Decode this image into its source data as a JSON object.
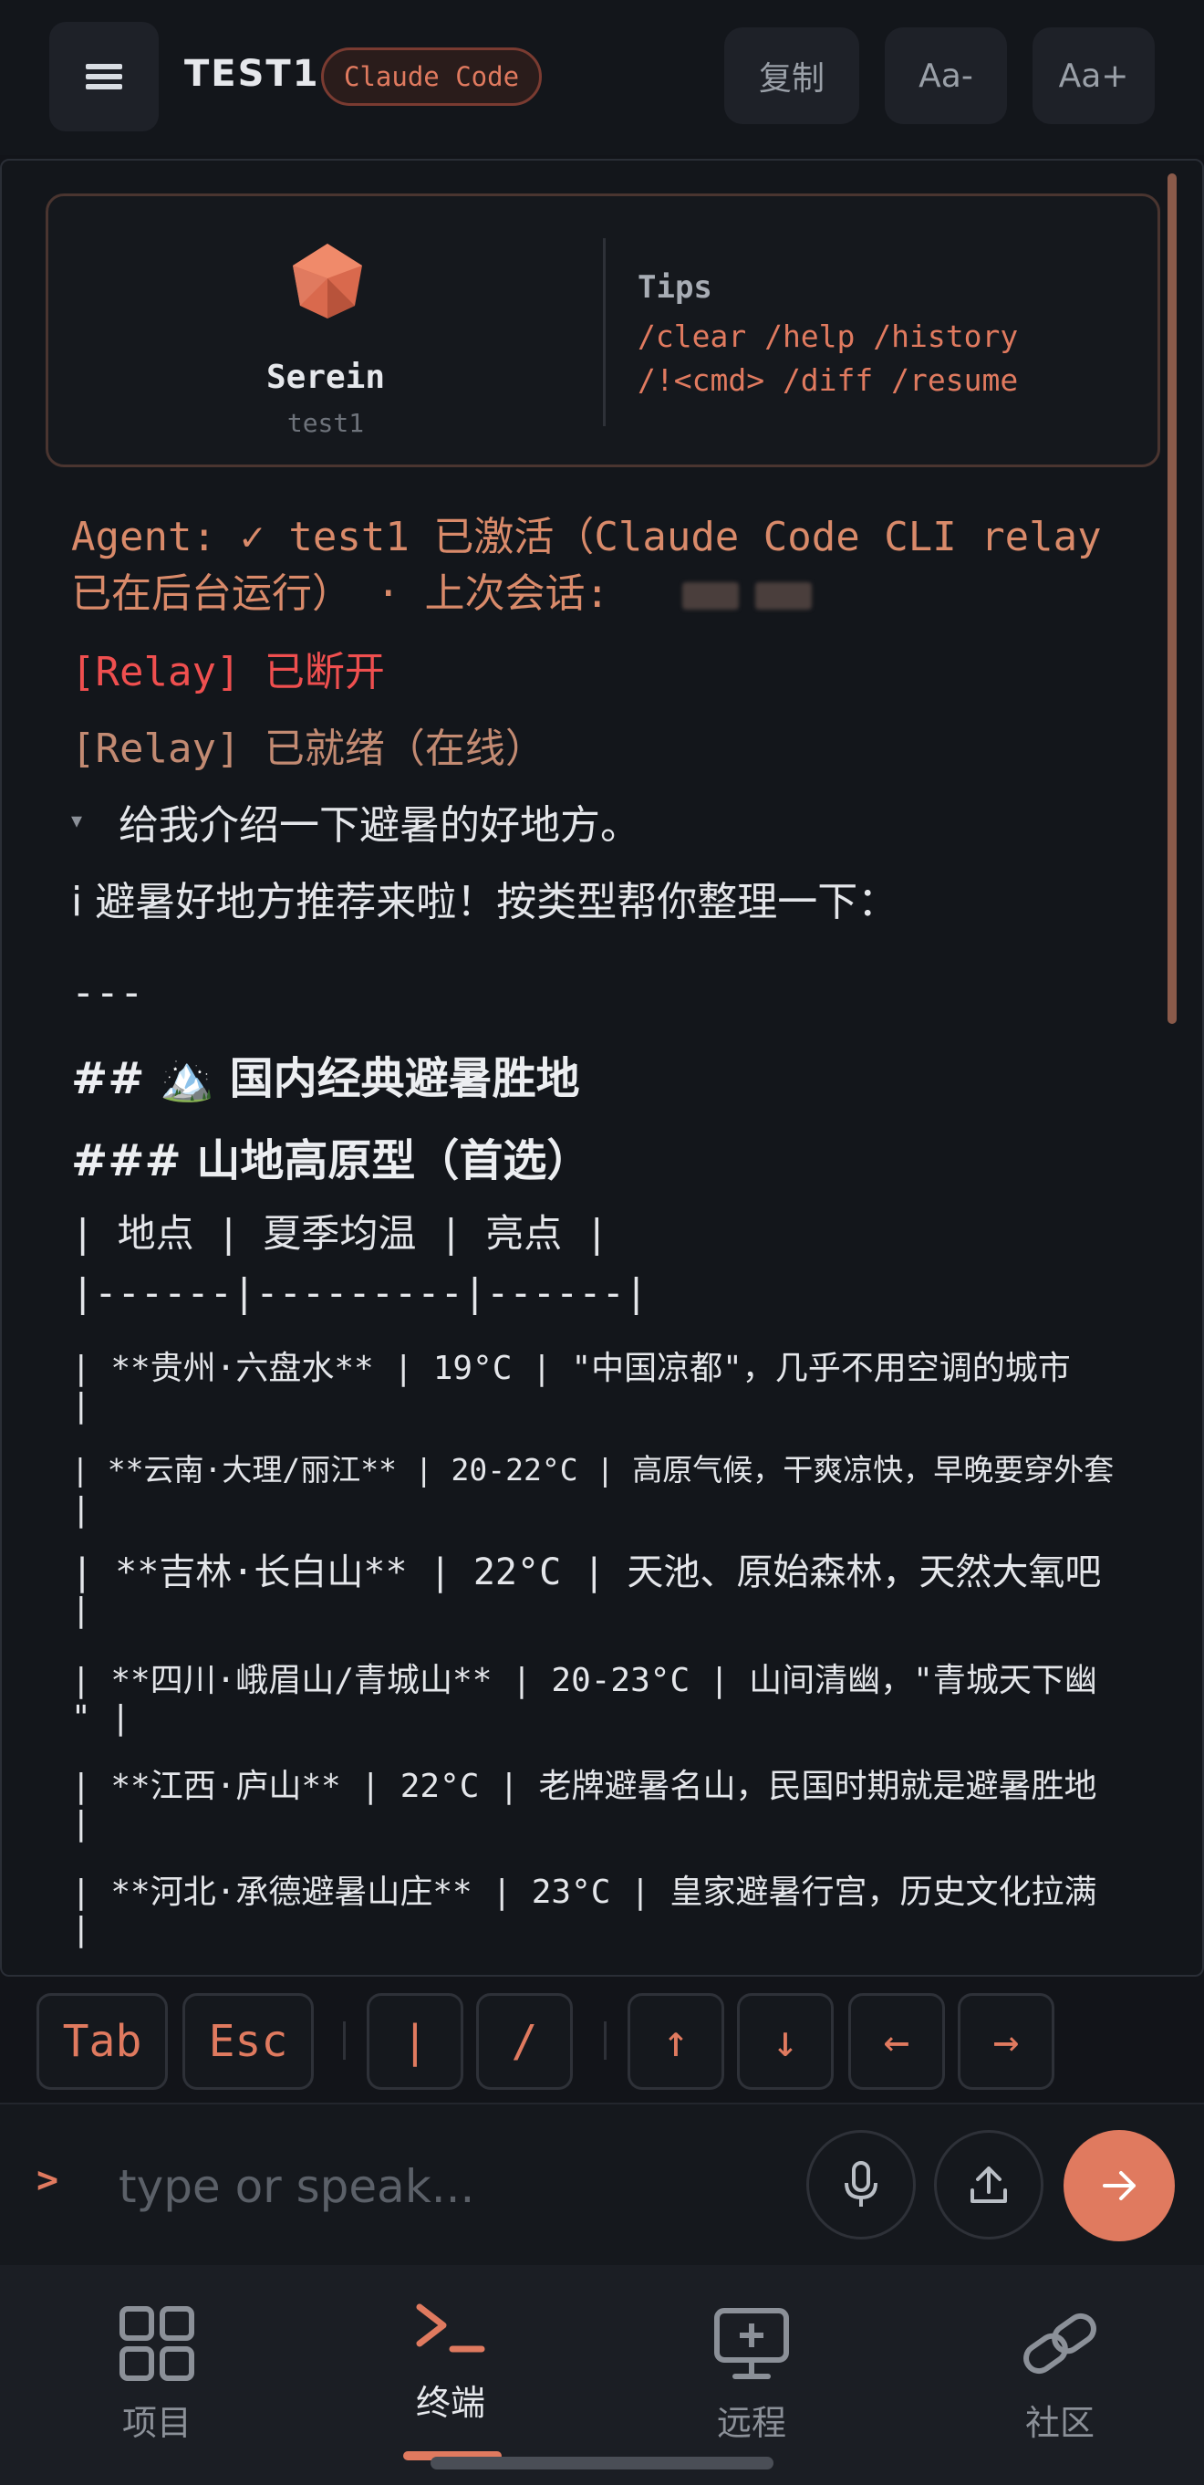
{
  "header": {
    "title": "TEST1",
    "badge": "Claude Code",
    "copy_label": "复制",
    "font_decrease_label": "Aa-",
    "font_increase_label": "Aa+"
  },
  "agent_card": {
    "name": "Serein",
    "id": "test1",
    "tips_title": "Tips",
    "tips_line1": "/clear /help /history",
    "tips_line2": "/!<cmd> /diff /resume"
  },
  "terminal": {
    "agent_line1": "Agent: ✓ test1 已激活（Claude Code CLI relay",
    "agent_line2": "已在后台运行） · 上次会话:",
    "relay_disconnected": "[Relay] 已断开",
    "relay_ready": "[Relay] 已就绪（在线）",
    "user_bullet": "▾",
    "user_message": "给我介绍一下避暑的好地方。",
    "assistant_intro": "i 避暑好地方推荐来啦！按类型帮你整理一下：",
    "rule": "---",
    "heading2": "## 🏔️ 国内经典避暑胜地",
    "heading3": "### 山地高原型（首选）",
    "table_header": "| 地点 | 夏季均温 | 亮点 |",
    "table_sep": "|------|---------|------|",
    "rows": [
      {
        "line1": "| **贵州·六盘水** | 19°C | \"中国凉都\"，几乎不用空调的城市",
        "line2": "|"
      },
      {
        "line1": "| **云南·大理/丽江** | 20-22°C | 高原气候，干爽凉快，早晚要穿外套",
        "line2": "|"
      },
      {
        "line1": "| **吉林·长白山** | 22°C | 天池、原始森林，天然大氧吧",
        "line2": "|"
      },
      {
        "line1": "| **四川·峨眉山/青城山** | 20-23°C | 山间清幽，\"青城天下幽",
        "line2": "\" |"
      },
      {
        "line1": "| **江西·庐山** | 22°C | 老牌避暑名山，民国时期就是避暑胜地",
        "line2": "|"
      },
      {
        "line1": "| **河北·承德避暑山庄** | 23°C | 皇家避暑行宫，历史文化拉满",
        "line2": "|"
      }
    ]
  },
  "keys": [
    "Tab",
    "Esc",
    "|",
    "/",
    "↑",
    "↓",
    "←",
    "→"
  ],
  "input": {
    "prompt": ">",
    "placeholder": "type or speak..."
  },
  "nav": [
    {
      "label": "项目",
      "icon": "grid-icon"
    },
    {
      "label": "终端",
      "icon": "terminal-icon"
    },
    {
      "label": "远程",
      "icon": "remote-desktop-icon"
    },
    {
      "label": "社区",
      "icon": "link-icon"
    }
  ],
  "colors": {
    "accent": "#e07a5f",
    "background": "#13161b",
    "error": "#ef4f4f"
  }
}
